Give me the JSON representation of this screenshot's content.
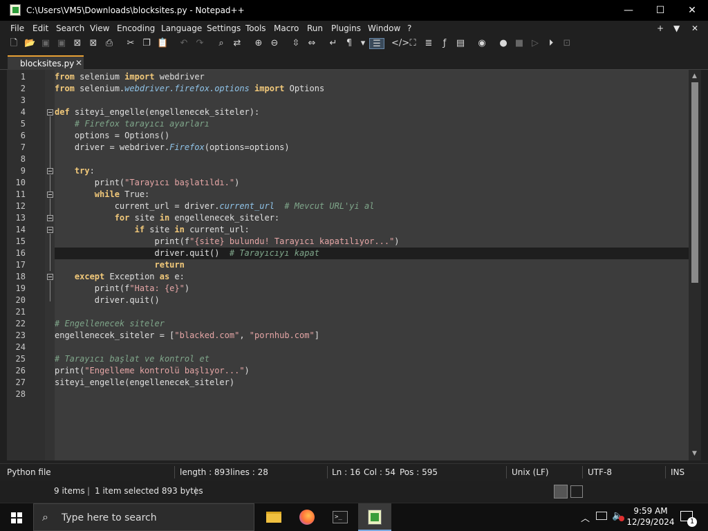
{
  "window": {
    "title": "C:\\Users\\VM5\\Downloads\\blocksites.py - Notepad++",
    "controls": {
      "minimize": "—",
      "maximize": "☐",
      "close": "✕"
    }
  },
  "menu": [
    "File",
    "Edit",
    "Search",
    "View",
    "Encoding",
    "Language",
    "Settings",
    "Tools",
    "Macro",
    "Run",
    "Plugins",
    "Window",
    "?"
  ],
  "menu_right": {
    "plus": "+",
    "down": "▼",
    "close": "✕"
  },
  "tab": {
    "label": "blocksites.py",
    "close": "✕"
  },
  "code_lines": [
    {
      "n": "1"
    },
    {
      "n": "2"
    },
    {
      "n": "3"
    },
    {
      "n": "4"
    },
    {
      "n": "5"
    },
    {
      "n": "6"
    },
    {
      "n": "7"
    },
    {
      "n": "8"
    },
    {
      "n": "9"
    },
    {
      "n": "10"
    },
    {
      "n": "11"
    },
    {
      "n": "12"
    },
    {
      "n": "13"
    },
    {
      "n": "14"
    },
    {
      "n": "15"
    },
    {
      "n": "16"
    },
    {
      "n": "17"
    },
    {
      "n": "18"
    },
    {
      "n": "19"
    },
    {
      "n": "20"
    },
    {
      "n": "21"
    },
    {
      "n": "22"
    },
    {
      "n": "23"
    },
    {
      "n": "24"
    },
    {
      "n": "25"
    },
    {
      "n": "26"
    },
    {
      "n": "27"
    },
    {
      "n": "28"
    }
  ],
  "code": {
    "l1": {
      "a": "from",
      "b": " selenium ",
      "c": "import",
      "d": " webdriver"
    },
    "l2": {
      "a": "from",
      "b": " selenium.",
      "c": "webdriver.firefox.options",
      "d": " ",
      "e": "import",
      "f": " Options"
    },
    "l4": {
      "a": "def",
      "b": " siteyi_engelle(engellenecek_siteler):"
    },
    "l5": {
      "a": "    ",
      "b": "# Firefox tarayıcı ayarları"
    },
    "l6": {
      "a": "    options = Options()"
    },
    "l7": {
      "a": "    driver = webdriver.",
      "b": "Firefox",
      "c": "(options=options)"
    },
    "l9": {
      "a": "    ",
      "b": "try",
      "c": ":"
    },
    "l10": {
      "a": "        print(",
      "b": "\"Tarayıcı başlatıldı.\"",
      "c": ")"
    },
    "l11": {
      "a": "        ",
      "b": "while",
      "c": " True:"
    },
    "l12": {
      "a": "            current_url = driver.",
      "b": "current_url",
      "c": "  ",
      "d": "# Mevcut URL'yi al"
    },
    "l13": {
      "a": "            ",
      "b": "for",
      "c": " site ",
      "d": "in",
      "e": " engellenecek_siteler:"
    },
    "l14": {
      "a": "                ",
      "b": "if",
      "c": " site ",
      "d": "in",
      "e": " current_url:"
    },
    "l15": {
      "a": "                    print(f",
      "b": "\"{site} bulundu! Tarayıcı kapatılıyor...\"",
      "c": ")"
    },
    "l16": {
      "a": "                    driver.quit()  ",
      "b": "# Tarayıcıyı kapat"
    },
    "l17": {
      "a": "                    ",
      "b": "return"
    },
    "l18": {
      "a": "    ",
      "b": "except",
      "c": " Exception ",
      "d": "as",
      "e": " e:"
    },
    "l19": {
      "a": "        print(f",
      "b": "\"Hata: {e}\"",
      "c": ")"
    },
    "l20": {
      "a": "        driver.quit()"
    },
    "l22": {
      "a": "# Engellenecek siteler"
    },
    "l23": {
      "a": "engellenecek_siteler = [",
      "b": "\"blacked.com\"",
      "c": ", ",
      "d": "\"pornhub.com\"",
      "e": "]"
    },
    "l25": {
      "a": "# Tarayıcı başlat ve kontrol et"
    },
    "l26": {
      "a": "print(",
      "b": "\"Engelleme kontrolü başlıyor...\"",
      "c": ")"
    },
    "l27": {
      "a": "siteyi_engelle(engellenecek_siteler)"
    }
  },
  "status": {
    "filetype": "Python file",
    "length": "length : 893",
    "lines": "lines : 28",
    "ln": "Ln : 16",
    "col": "Col : 54",
    "pos": "Pos : 595",
    "eol": "Unix (LF)",
    "encoding": "UTF-8",
    "mode": "INS"
  },
  "explorer": {
    "items": "9 items",
    "selected": "1 item selected  893 bytes"
  },
  "taskbar": {
    "search_placeholder": "Type here to search",
    "time": "9:59 AM",
    "date": "12/29/2024",
    "notif_count": "1"
  },
  "colors": {
    "keyword": "#f2c97a",
    "string": "#e6a6a6",
    "comment": "#7fa68a",
    "italic_ident": "#8fc3e8",
    "editor_bg": "#3c3c3c",
    "current_line": "#1e1e1e",
    "tab_accent": "#e8a034"
  },
  "icons": {
    "toolbar": [
      "new-file-icon",
      "open-file-icon",
      "save-icon",
      "save-all-icon",
      "close-icon",
      "close-all-icon",
      "print-icon",
      "cut-icon",
      "copy-icon",
      "paste-icon",
      "undo-icon",
      "redo-icon",
      "find-icon",
      "replace-icon",
      "zoom-in-icon",
      "zoom-out-icon",
      "sync-vertical-icon",
      "sync-horizontal-icon",
      "word-wrap-icon",
      "show-all-chars-icon",
      "indent-guide-icon",
      "xml-tag-icon",
      "document-map-icon",
      "function-list-icon",
      "fx-icon",
      "folder-workspace-icon",
      "monitor-icon",
      "record-macro-icon",
      "stop-macro-icon",
      "play-macro-icon",
      "run-macro-icon",
      "save-macro-icon"
    ]
  }
}
